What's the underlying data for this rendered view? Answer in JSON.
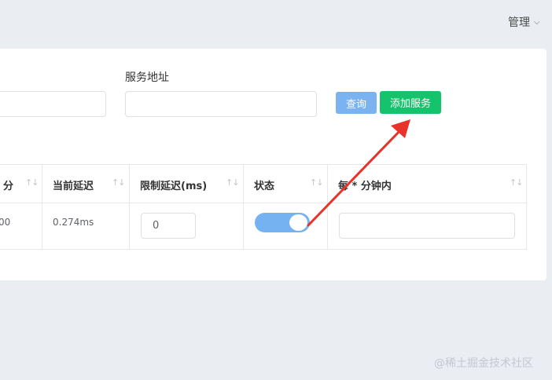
{
  "header": {
    "user_menu_label": "管理",
    "chevron": "⌄"
  },
  "filters": {
    "left_input_value": "",
    "service_address_label": "服务地址",
    "service_address_value": "",
    "query_button": "查询",
    "add_service_button": "添加服务"
  },
  "table": {
    "columns": [
      "分",
      "当前延迟",
      "限制延迟(ms)",
      "状态",
      "每 * 分钟内"
    ],
    "sort_icon": "↑↓",
    "rows": [
      {
        "col0": "00",
        "current_latency": "0.274ms",
        "limit_latency_value": "0",
        "status_on": true,
        "per_minute_value": ""
      }
    ]
  },
  "colors": {
    "primary": "#7ab3f0",
    "success": "#16c36d",
    "switch_on": "#74b2f2",
    "arrow": "#e8332a"
  },
  "watermark": "@稀土掘金技术社区"
}
